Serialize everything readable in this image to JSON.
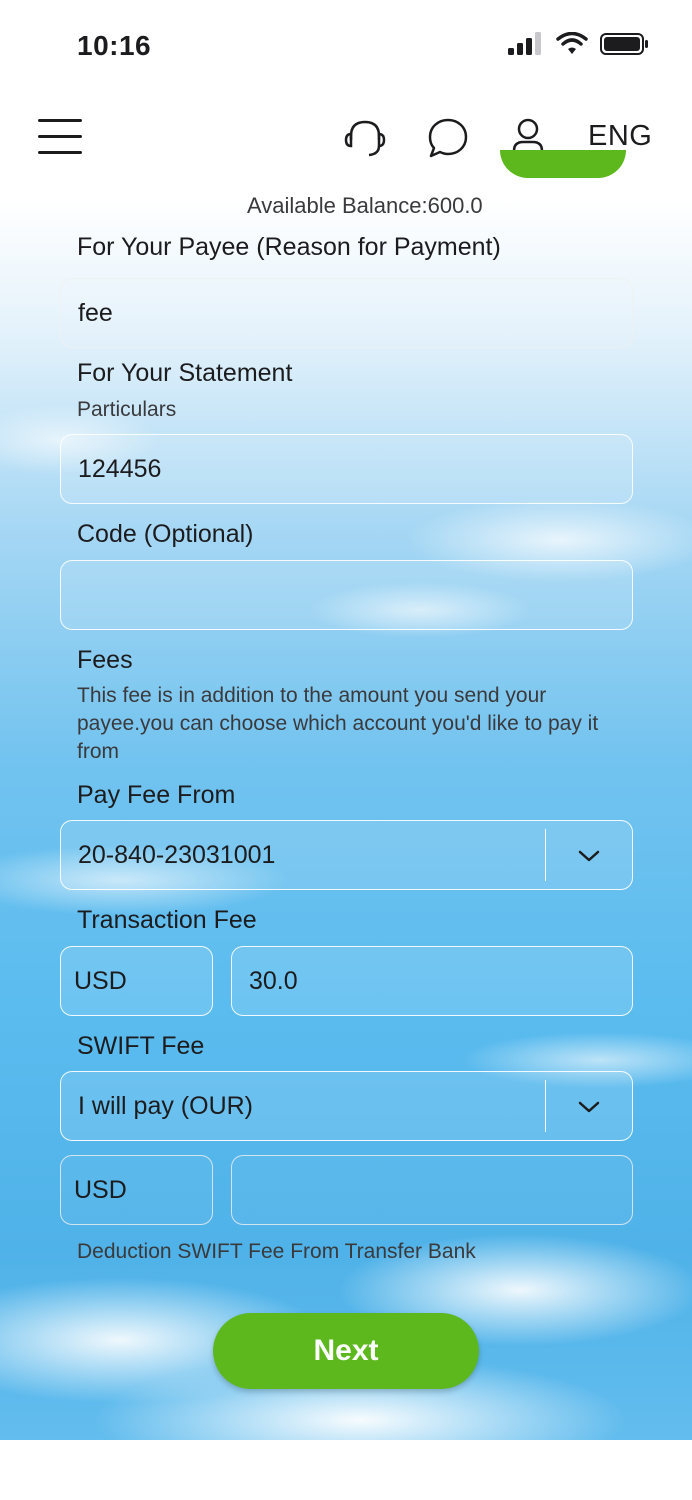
{
  "status_bar": {
    "time": "10:16"
  },
  "header": {
    "language": "ENG"
  },
  "available_balance": "Available Balance:600.0",
  "payee_reason": {
    "label": "For Your Payee (Reason for Payment)",
    "value": "fee"
  },
  "statement": {
    "label": "For Your Statement",
    "particulars_label": "Particulars",
    "particulars_value": "124456",
    "code_label": "Code (Optional)",
    "code_value": ""
  },
  "fees": {
    "label": "Fees",
    "description": "This fee is in addition to the amount you send your payee.you can choose which account you'd like to pay it from",
    "pay_fee_from_label": "Pay Fee From",
    "pay_fee_from_value": "20-840-23031001",
    "transaction_fee_label": "Transaction Fee",
    "transaction_fee_currency": "USD",
    "transaction_fee_amount": "30.0"
  },
  "swift_fee": {
    "label": "SWIFT Fee",
    "option": "I will pay (OUR)",
    "currency": "USD",
    "amount": "",
    "note": "Deduction SWIFT Fee From Transfer Bank"
  },
  "next_button": "Next",
  "colors": {
    "accent_green": "#5cb81c",
    "text": "#1c1c1e"
  }
}
